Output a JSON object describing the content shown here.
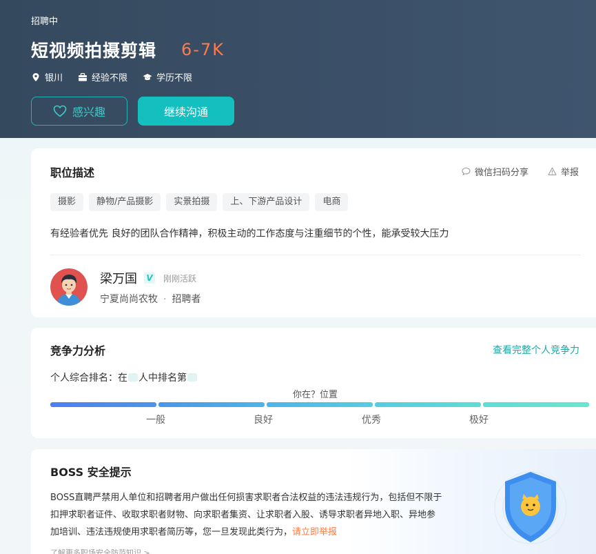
{
  "header": {
    "status": "招聘中",
    "job_title": "短视频拍摄剪辑",
    "salary": "6-7K",
    "meta": [
      {
        "icon": "location-pin-icon",
        "text": "银川"
      },
      {
        "icon": "briefcase-icon",
        "text": "经验不限"
      },
      {
        "icon": "graduation-cap-icon",
        "text": "学历不限"
      }
    ],
    "interest_button": "感兴趣",
    "chat_button": "继续沟通"
  },
  "description": {
    "title": "职位描述",
    "share": "微信扫码分享",
    "report": "举报",
    "tags": [
      "摄影",
      "静物/产品摄影",
      "实景拍摄",
      "上、下游产品设计",
      "电商"
    ],
    "text": "有经验者优先 良好的团队合作精神，积极主动的工作态度与注重细节的个性，能承受较大压力",
    "recruiter": {
      "name": "梁万国",
      "badge": "V",
      "active": "刚刚活跃",
      "company": "宁夏尚尚农牧",
      "separator": "·",
      "role": "招聘者"
    }
  },
  "competition": {
    "title": "竞争力分析",
    "link": "查看完整个人竞争力",
    "rank_prefix": "个人综合排名：在",
    "rank_middle": "人中排名第",
    "position_label": "你在？位置",
    "levels": [
      "一般",
      "良好",
      "优秀",
      "极好"
    ],
    "bar_colors": [
      "#4f7ff0",
      "#4c9de8",
      "#4fc3e6",
      "#5fdcd6",
      "#69e6cf"
    ]
  },
  "safety": {
    "title": "BOSS 安全提示",
    "text": "BOSS直聘严禁用人单位和招聘者用户做出任何损害求职者合法权益的违法违规行为，包括但不限于扣押求职者证件、收取求职者财物、向求职者集资、让求职者入股、诱导求职者异地入职、异地参加培训、违法违规使用求职者简历等，您一旦发现此类行为，",
    "link": "请立即举报",
    "learn_more": "了解更多职场安全防范知识 >"
  },
  "colors": {
    "accent": "#14bfbf",
    "salary": "#ff7a4c",
    "header_bg": "#35495e"
  }
}
